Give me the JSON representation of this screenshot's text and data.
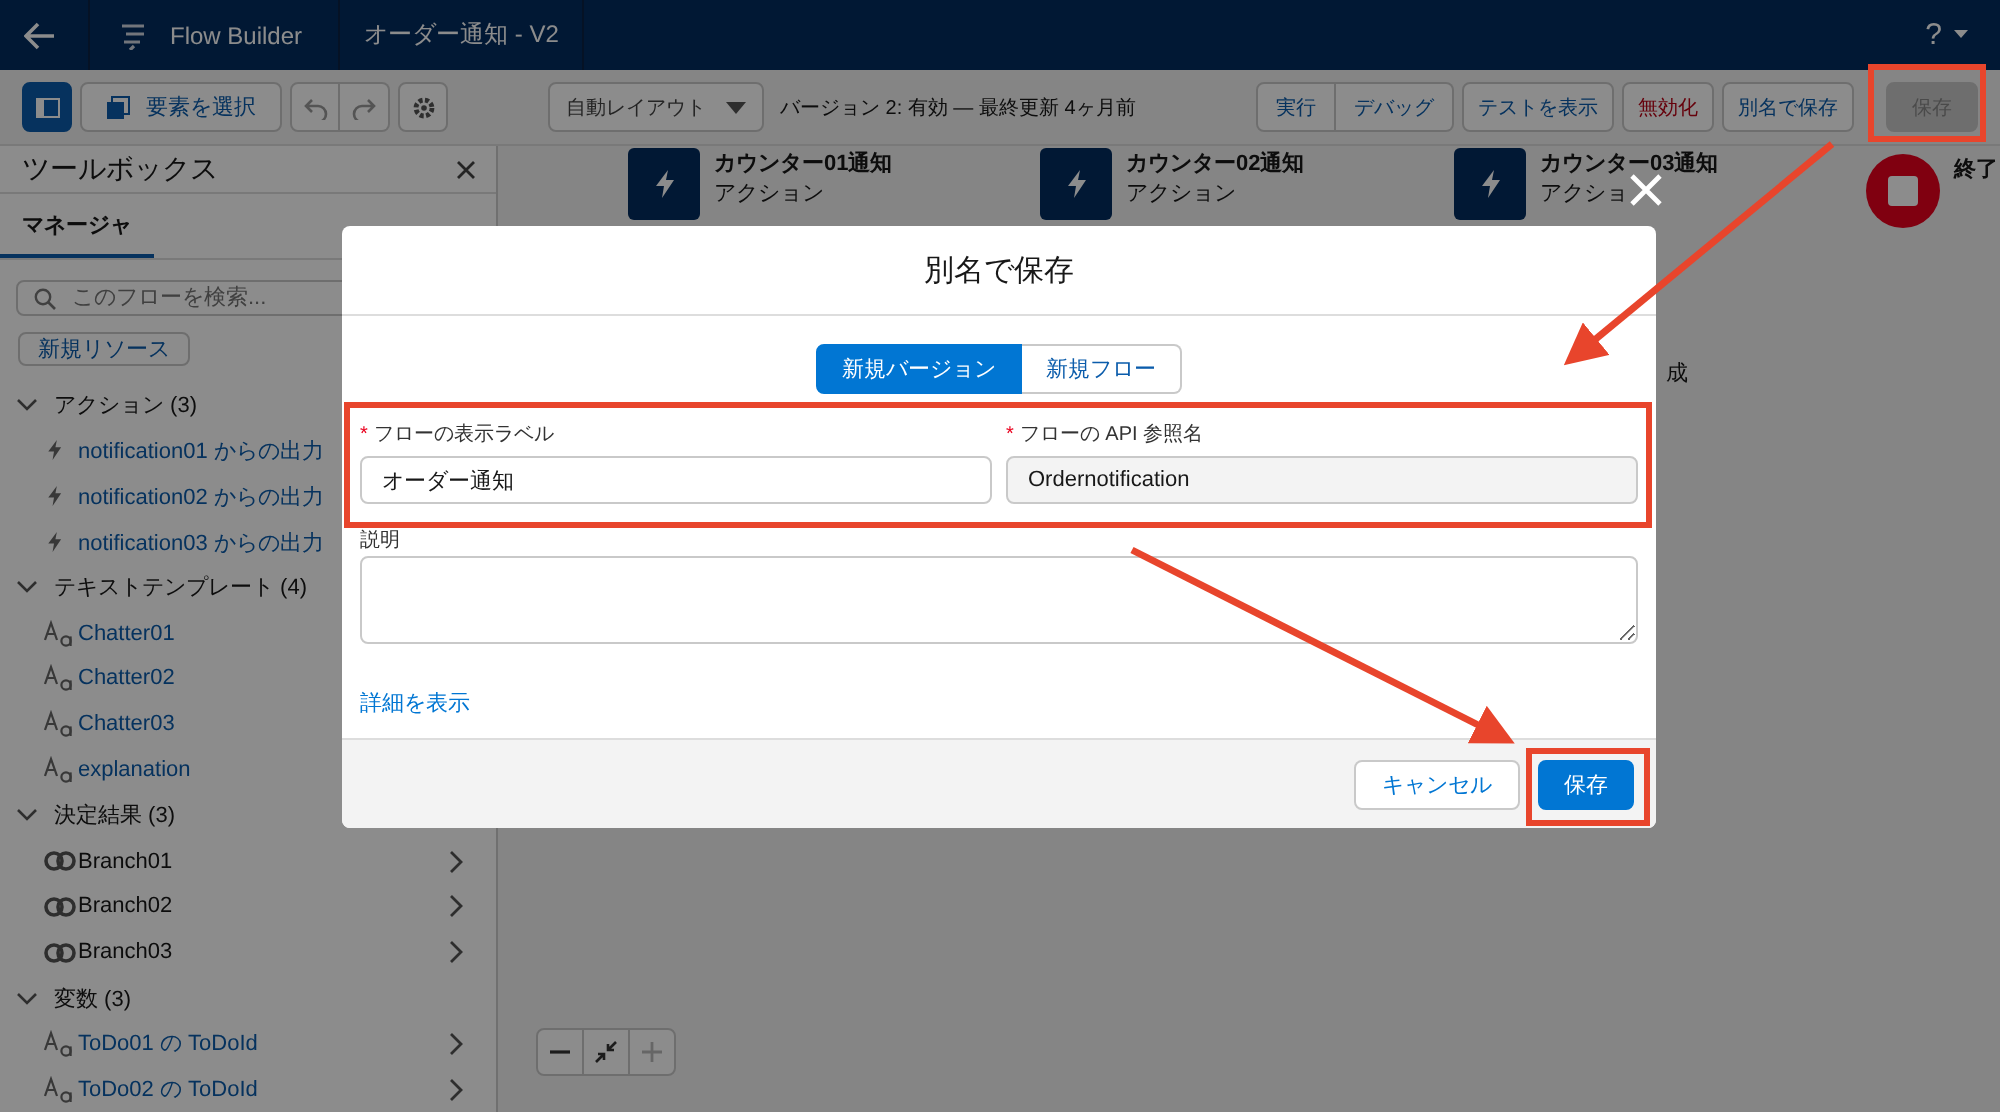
{
  "header": {
    "title": "Flow Builder",
    "flow_name": "オーダー通知 - V2",
    "help": "?"
  },
  "toolbar": {
    "select_button": "要素を選択",
    "layout_dropdown": "自動レイアウト",
    "version_info": "バージョン 2: 有効 — 最終更新 4ヶ月前",
    "buttons": [
      {
        "label": "実行",
        "kind": "group",
        "disabled": false
      },
      {
        "label": "デバッグ",
        "kind": "group",
        "disabled": false
      },
      {
        "label": "テストを表示",
        "kind": "plain",
        "disabled": false
      },
      {
        "label": "無効化",
        "kind": "danger",
        "disabled": false
      },
      {
        "label": "別名で保存",
        "kind": "plain",
        "disabled": false
      },
      {
        "label": "保存",
        "kind": "plain",
        "disabled": true
      }
    ]
  },
  "toolbox": {
    "title": "ツールボックス",
    "tabs": [
      {
        "label": "マネージャ",
        "selected": true
      }
    ],
    "search": {
      "placeholder": "このフローを検索..."
    },
    "new_resource_button": "新規リソース",
    "sections": [
      {
        "label": "アクション (3)",
        "expanded": true,
        "children": [
          {
            "label": "notification01 からの出力",
            "kind": "action"
          },
          {
            "label": "notification02 からの出力",
            "kind": "action"
          },
          {
            "label": "notification03 からの出力",
            "kind": "action"
          }
        ]
      },
      {
        "label": "テキストテンプレート (4)",
        "expanded": true,
        "children": [
          {
            "label": "Chatter01",
            "kind": "text"
          },
          {
            "label": "Chatter02",
            "kind": "text"
          },
          {
            "label": "Chatter03",
            "kind": "text"
          },
          {
            "label": "explanation",
            "kind": "text"
          }
        ]
      },
      {
        "label": "決定結果 (3)",
        "expanded": true,
        "children": [
          {
            "label": "Branch01",
            "kind": "decision",
            "drill": true
          },
          {
            "label": "Branch02",
            "kind": "decision",
            "drill": true
          },
          {
            "label": "Branch03",
            "kind": "decision",
            "drill": true
          }
        ]
      },
      {
        "label": "変数 (3)",
        "expanded": true,
        "children": [
          {
            "label": "ToDo01 の ToDoId",
            "kind": "variable",
            "drill": true
          },
          {
            "label": "ToDo02 の ToDoId",
            "kind": "variable",
            "drill": true
          }
        ]
      }
    ]
  },
  "canvas": {
    "nodes": [
      {
        "title": "カウンター01通知",
        "subtitle": "アクション",
        "kind": "action"
      },
      {
        "title": "カウンター02通知",
        "subtitle": "アクション",
        "kind": "action"
      },
      {
        "title": "カウンター03通知",
        "subtitle": "アクショ",
        "kind": "action"
      },
      {
        "title": "終了",
        "kind": "end"
      }
    ],
    "fragment": "成",
    "zoom_controls": [
      {
        "kind": "zoom-out",
        "disabled": false
      },
      {
        "kind": "fit",
        "disabled": false
      },
      {
        "kind": "zoom-in",
        "disabled": true
      }
    ]
  },
  "modal": {
    "title": "別名で保存",
    "modes": [
      {
        "label": "新規バージョン",
        "selected": true
      },
      {
        "label": "新規フロー",
        "selected": false
      }
    ],
    "fields": [
      {
        "label": "フローの表示ラベル",
        "required_mark": "*",
        "value": "オーダー通知",
        "disabled": false
      },
      {
        "label": "フローの API 参照名",
        "required_mark": "*",
        "value": "Ordernotification",
        "disabled": true
      }
    ],
    "description": {
      "label": "説明"
    },
    "details_link": "詳細を表示",
    "cancel_button": "キャンセル",
    "save_button": "保存"
  }
}
